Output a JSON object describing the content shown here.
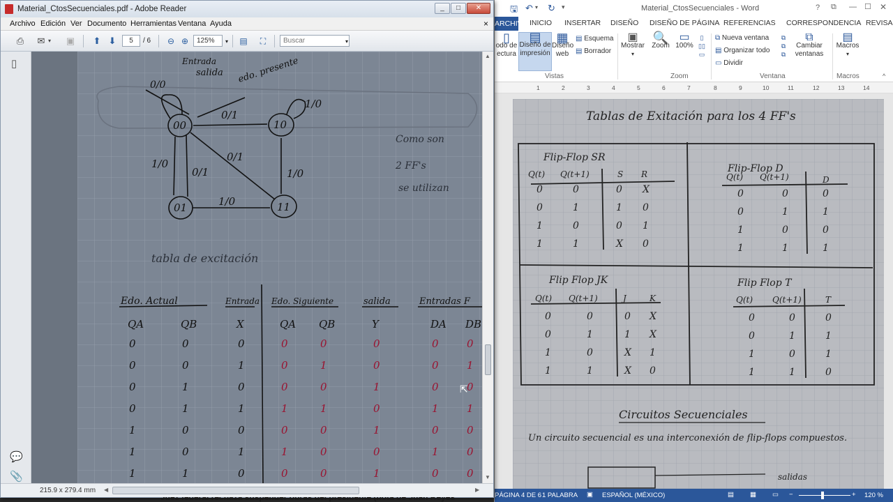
{
  "reader": {
    "title": "Material_CtosSecuenciales.pdf - Adobe Reader",
    "window_buttons": [
      "_",
      "□",
      "✕"
    ],
    "menu": [
      "Archivo",
      "Edición",
      "Ver",
      "Documento",
      "Herramientas",
      "Ventana",
      "Ayuda"
    ],
    "menu_close": "×",
    "toolbar": {
      "page_current": "5",
      "page_total": "/ 6",
      "zoom": "125%",
      "search_placeholder": "Buscar"
    },
    "page_size": "215.9 x 279.4 mm",
    "page_content": {
      "diagram": {
        "annotations": [
          "Entrada",
          "0/0",
          "salida",
          "edo. presente"
        ],
        "states": [
          "00",
          "10",
          "01",
          "11"
        ],
        "transitions": [
          "0/1",
          "1/0",
          "1/0",
          "0/1",
          "0/1",
          "1/0",
          "1/0"
        ],
        "side_note": [
          "Como son",
          "2 FF's",
          "se utilizan"
        ]
      },
      "table_title": "tabla de excitación",
      "group_headers": [
        "Edo. Actual",
        "Entrada",
        "Edo. Siguiente",
        "salida",
        "Entradas F"
      ],
      "col_headers": [
        "QA",
        "QB",
        "X",
        "QA",
        "QB",
        "Y",
        "DA",
        "DB"
      ],
      "rows": [
        [
          "0",
          "0",
          "0",
          "0",
          "0",
          "0",
          "0",
          "0"
        ],
        [
          "0",
          "0",
          "1",
          "0",
          "1",
          "0",
          "0",
          "1"
        ],
        [
          "0",
          "1",
          "0",
          "0",
          "0",
          "1",
          "0",
          "0"
        ],
        [
          "0",
          "1",
          "1",
          "1",
          "1",
          "0",
          "1",
          "1"
        ],
        [
          "1",
          "0",
          "0",
          "0",
          "0",
          "1",
          "0",
          "0"
        ],
        [
          "1",
          "0",
          "1",
          "1",
          "0",
          "0",
          "1",
          "0"
        ],
        [
          "1",
          "1",
          "0",
          "0",
          "0",
          "1",
          "0",
          "0"
        ]
      ]
    }
  },
  "word": {
    "title": "Material_CtosSecuenciales - Word",
    "tabs": [
      "ARCHIVO",
      "INICIO",
      "INSERTAR",
      "DISEÑO",
      "DISEÑO DE PÁGINA",
      "REFERENCIAS",
      "CORRESPONDENCIA",
      "REVISAR"
    ],
    "ribbon": {
      "vistas": [
        "odo de ectura",
        "Diseño de impresión",
        "Diseño web"
      ],
      "esquema": "Esquema",
      "borrador": "Borrador",
      "mostrar": "Mostrar",
      "zoom": "Zoom",
      "zoom100": "100%",
      "nueva_ventana": "Nueva ventana",
      "organizar_todo": "Organizar todo",
      "dividir": "Dividir",
      "cambiar_ventanas": "Cambiar ventanas",
      "macros": "Macros",
      "groups": [
        "Vistas",
        "Zoom",
        "Ventana",
        "Macros"
      ]
    },
    "ruler": [
      "1",
      "2",
      "3",
      "4",
      "5",
      "6",
      "7",
      "8",
      "9",
      "10",
      "11",
      "12",
      "13",
      "14"
    ],
    "page_content": {
      "title": "Tablas de Exitación para los 4 FF's",
      "sr": {
        "title": "Flip-Flop SR",
        "headers": [
          "Q(t)",
          "Q(t+1)",
          "S",
          "R"
        ],
        "rows": [
          [
            "0",
            "0",
            "0",
            "X"
          ],
          [
            "0",
            "1",
            "1",
            "0"
          ],
          [
            "1",
            "0",
            "0",
            "1"
          ],
          [
            "1",
            "1",
            "X",
            "0"
          ]
        ]
      },
      "d": {
        "title": "Flip-Flop D",
        "headers": [
          "Q(t)",
          "Q(t+1)",
          "D"
        ],
        "rows": [
          [
            "0",
            "0",
            "0"
          ],
          [
            "0",
            "1",
            "1"
          ],
          [
            "1",
            "0",
            "0"
          ],
          [
            "1",
            "1",
            "1"
          ]
        ]
      },
      "jk": {
        "title": "Flip Flop JK",
        "headers": [
          "Q(t)",
          "Q(t+1)",
          "J",
          "K"
        ],
        "rows": [
          [
            "0",
            "0",
            "0",
            "X"
          ],
          [
            "0",
            "1",
            "1",
            "X"
          ],
          [
            "1",
            "0",
            "X",
            "1"
          ],
          [
            "1",
            "1",
            "X",
            "0"
          ]
        ]
      },
      "t": {
        "title": "Flip Flop T",
        "headers": [
          "Q(t)",
          "Q(t+1)",
          "T"
        ],
        "rows": [
          [
            "0",
            "0",
            "0"
          ],
          [
            "0",
            "1",
            "1"
          ],
          [
            "1",
            "0",
            "1"
          ],
          [
            "1",
            "1",
            "0"
          ]
        ]
      },
      "section_title": "Circuitos Secuenciales",
      "paragraph": "Un circuito secuencial es una interconexión de flip-flops compuestos.",
      "outputs": "salidas"
    },
    "status": {
      "page": "PÁGINA 4 DE 6",
      "words": "1 PALABRA",
      "language": "ESPAÑOL (MÉXICO)",
      "zoom": "120 %"
    }
  },
  "ticker": "Juez federal rechaza suspender obras del presidente (nota de Juan Reyes"
}
